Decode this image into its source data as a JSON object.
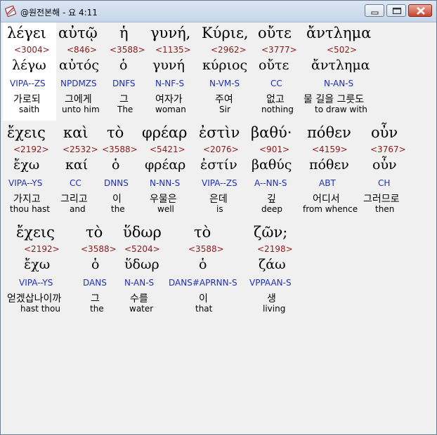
{
  "window": {
    "title": "@원전본해 - 요 4:11"
  },
  "rows": [
    {
      "words": [
        {
          "greek": "λέγει",
          "strong": "<3004>",
          "lemma": "λέγω",
          "parse": "VIPA--ZS",
          "korean": "가로되",
          "english": "saith"
        },
        {
          "greek": "αὐτῷ",
          "strong": "<846>",
          "lemma": "αὐτός",
          "parse": "NPDMZS",
          "korean": "그에게",
          "english": "unto him"
        },
        {
          "greek": "ἡ",
          "strong": "<3588>",
          "lemma": "ὁ",
          "parse": "DNFS",
          "korean": "그",
          "english": "The"
        },
        {
          "greek": "γυνή,",
          "strong": "<1135>",
          "lemma": "γυνή",
          "parse": "N-NF-S",
          "korean": "여자가",
          "english": "woman"
        },
        {
          "greek": "Κύριε,",
          "strong": "<2962>",
          "lemma": "κύριος",
          "parse": "N-VM-S",
          "korean": "주여",
          "english": "Sir"
        },
        {
          "greek": "οὔτε",
          "strong": "<3777>",
          "lemma": "οὔτε",
          "parse": "CC",
          "korean": "없고",
          "english": "nothing"
        },
        {
          "greek": "ἄντλημα",
          "strong": "<502>",
          "lemma": "ἄντλημα",
          "parse": "N-AN-S",
          "korean": "물 길을 그릇도",
          "english": "to draw with"
        }
      ]
    },
    {
      "words": [
        {
          "greek": "ἔχεις",
          "strong": "<2192>",
          "lemma": "ἔχω",
          "parse": "VIPA--YS",
          "korean": "가지고",
          "english": "thou hast"
        },
        {
          "greek": "καὶ",
          "strong": "<2532>",
          "lemma": "καί",
          "parse": "CC",
          "korean": "그리고",
          "english": "and"
        },
        {
          "greek": "τὸ",
          "strong": "<3588>",
          "lemma": "ὁ",
          "parse": "DNNS",
          "korean": "이",
          "english": "the"
        },
        {
          "greek": "φρέαρ",
          "strong": "<5421>",
          "lemma": "φρέαρ",
          "parse": "N-NN-S",
          "korean": "우물은",
          "english": "well"
        },
        {
          "greek": "ἐστὶν",
          "strong": "<2076>",
          "lemma": "ἐστίν",
          "parse": "VIPA--ZS",
          "korean": "은데",
          "english": "is"
        },
        {
          "greek": "βαθύ·",
          "strong": "<901>",
          "lemma": "βαθύς",
          "parse": "A--NN-S",
          "korean": "깊",
          "english": "deep"
        },
        {
          "greek": "πόθεν",
          "strong": "<4159>",
          "lemma": "πόθεν",
          "parse": "ABT",
          "korean": "어디서",
          "english": "from whence"
        },
        {
          "greek": "οὖν",
          "strong": "<3767>",
          "lemma": "οὖν",
          "parse": "CH",
          "korean": "그러므로",
          "english": "then"
        }
      ]
    },
    {
      "words": [
        {
          "greek": "ἔχεις",
          "strong": "<2192>",
          "lemma": "ἔχω",
          "parse": "VIPA--YS",
          "korean": "얻겠삽나이까",
          "english": "hast thou"
        },
        {
          "greek": "τὸ",
          "strong": "<3588>",
          "lemma": "ὁ",
          "parse": "DANS",
          "korean": "그",
          "english": "the"
        },
        {
          "greek": "ὕδωρ",
          "strong": "<5204>",
          "lemma": "ὕδωρ",
          "parse": "N-AN-S",
          "korean": "수를",
          "english": "water"
        },
        {
          "greek": "τὸ",
          "strong": "<3588>",
          "lemma": "ὁ",
          "parse": "DANS#APRNN-S",
          "korean": "이",
          "english": "that"
        },
        {
          "greek": "ζῶν;",
          "strong": "<2198>",
          "lemma": "ζάω",
          "parse": "VPPAAN-S",
          "korean": "생",
          "english": "living"
        }
      ]
    }
  ],
  "colors": {
    "strong": "#8b1a1a",
    "parse": "#1f2fb5",
    "text": "#000000",
    "background": "#f0f0f0",
    "selection": "#ffffff"
  },
  "icons": {
    "app": "app-icon",
    "minimize": "minimize-icon",
    "maximize": "maximize-icon",
    "close": "close-icon"
  }
}
